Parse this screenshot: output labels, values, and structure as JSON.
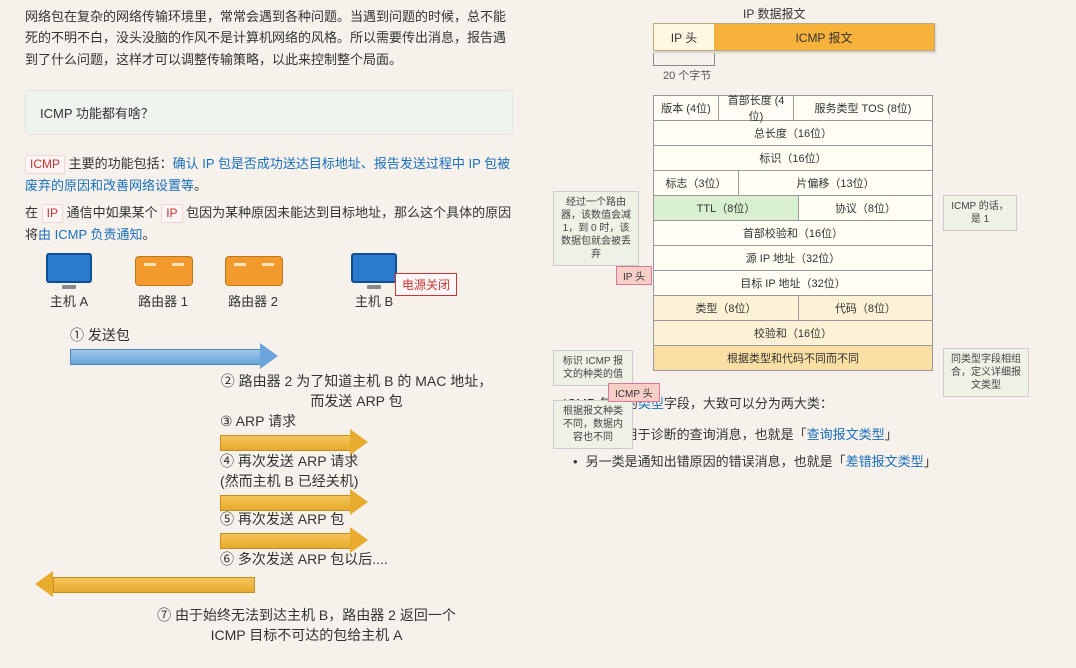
{
  "left": {
    "intro": "网络包在复杂的网络传输环境里，常常会遇到各种问题。当遇到问题的时候，总不能死的不明不白，没头没脑的作风不是计算机网络的风格。所以需要传出消息，报告遇到了什么问题，这样才可以调整传输策略，以此来控制整个局面。",
    "callout": "ICMP 功能都有啥？",
    "pill_icmp": "ICMP",
    "func_prefix": "  主要的功能包括：",
    "func_blue": "确认 IP 包是否成功送达目标地址、报告发送过程中 IP 包被废弃的原因和改善网络设置等",
    "func_suffix": "。",
    "p2_a": "在 ",
    "p2_pill1": "IP",
    "p2_b": " 通信中如果某个 ",
    "p2_pill2": "IP",
    "p2_c": " 包因为某种原因未能达到目标地址，那么这个具体的原因将",
    "p2_blue": "由 ICMP 负责通知",
    "p2_d": "。",
    "hostA": "主机 A",
    "router1": "路由器 1",
    "router2": "路由器 2",
    "hostB": "主机 B",
    "power_off": "电源关闭",
    "step1": "① 发送包",
    "step2a": "② 路由器 2 为了知道主机 B 的 MAC 地址，",
    "step2b": "而发送 ARP 包",
    "step3": "③ ARP 请求",
    "step4a": "④ 再次发送 ARP 请求",
    "step4b": "(然而主机 B 已经关机)",
    "step5": "⑤ 再次发送 ARP 包",
    "step6": "⑥ 多次发送 ARP 包以后....",
    "step7a": "⑦ 由于始终无法到达主机 B，路由器 2 返回一个",
    "step7b": "ICMP 目标不可达的包给主机 A"
  },
  "right": {
    "ip_datagram": "IP 数据报文",
    "bar_ip": "IP 头",
    "bar_icmp": "ICMP 报文",
    "brace": "20 个字节",
    "row1_a": "版本 (4位)",
    "row1_b": "首部长度 (4位)",
    "row1_c": "服务类型 TOS (8位)",
    "row2": "总长度（16位）",
    "row3": "标识（16位）",
    "row4_a": "标志（3位）",
    "row4_b": "片偏移（13位）",
    "row5_a": "TTL（8位）",
    "row5_b": "协议（8位）",
    "row6": "首部校验和（16位）",
    "row7": "源 IP 地址（32位）",
    "row8": "目标 IP 地址（32位）",
    "row9_a": "类型（8位）",
    "row9_b": "代码（8位）",
    "row10": "校验和（16位）",
    "row11": "根据类型和代码不同而不同",
    "note_ttl": "经过一个路由器，该数值会减 1，到 0 时，该数据包就会被丢弃",
    "note_proto": "ICMP 的话，是 1",
    "note_type": "标识 ICMP 报文的种类的值",
    "note_code": "同类型字段相组合，定义详细报文类型",
    "note_content": "根据报文种类不同，数据内容也不同",
    "tag_ip": "IP 头",
    "tag_icmp": "ICMP 头",
    "para_a": "ICMP 包头的",
    "para_link": "类型",
    "para_b": "字段，大致可以分为两大类：",
    "bullet1_a": "一类是用于诊断的查询消息，也就是「",
    "bullet1_link": "查询报文类型",
    "bullet1_b": "」",
    "bullet2_a": "另一类是通知出错原因的错误消息，也就是「",
    "bullet2_link": "差错报文类型",
    "bullet2_b": "」"
  }
}
